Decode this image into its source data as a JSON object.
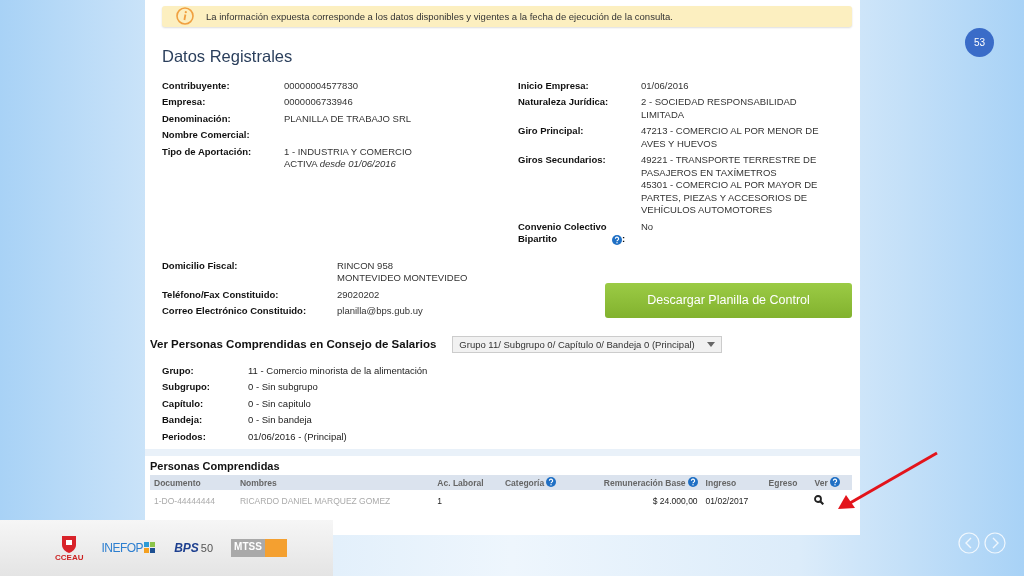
{
  "notice": {
    "text": "La información expuesta corresponde a los datos disponibles y vigentes a la fecha de ejecución de la consulta."
  },
  "title": "Datos Registrales",
  "fields_left": [
    {
      "label": "Contribuyente:",
      "values": [
        "00000004577830"
      ]
    },
    {
      "label": "Empresa:",
      "values": [
        "0000006733946"
      ]
    },
    {
      "label": "Denominación:",
      "values": [
        "PLANILLA DE TRABAJO SRL"
      ]
    },
    {
      "label": "Nombre Comercial:"
    },
    {
      "label": "Tipo de Aportación:",
      "values": [
        "1 - INDUSTRIA Y COMERCIO",
        "ACTIVA *desde 01/06/2016*"
      ]
    }
  ],
  "fields_right": [
    {
      "label": "Inicio Empresa:",
      "values": [
        "01/06/2016"
      ]
    },
    {
      "label": "Naturaleza Jurídica:",
      "values": [
        "2 - SOCIEDAD RESPONSABILIDAD LIMITADA"
      ]
    },
    {
      "label": "Giro Principal:",
      "values": [
        "47213 - COMERCIO AL POR MENOR DE AVES Y HUEVOS"
      ]
    },
    {
      "label": "Giros Secundarios:",
      "values": [
        "49221 - TRANSPORTE TERRESTRE DE PASAJEROS EN TAXÍMETROS",
        "45301 - COMERCIO AL POR MAYOR DE PARTES, PIEZAS Y ACCESORIOS DE VEHÍCULOS AUTOMOTORES"
      ]
    },
    {
      "label": "Convenio Colectivo Bipartito",
      "help": true,
      "suffix": ":",
      "values": [
        "No"
      ]
    }
  ],
  "contact": [
    {
      "label": "Domicilio Fiscal:",
      "values": [
        "RINCON 958",
        "MONTEVIDEO MONTEVIDEO"
      ]
    },
    {
      "label": "Teléfono/Fax Constituido:",
      "values": [
        "29020202"
      ]
    },
    {
      "label": "Correo Electrónico Constituido:",
      "values": [
        "planilla@bps.gub.uy"
      ]
    }
  ],
  "download_button": "Descargar Planilla de Control",
  "consejo": {
    "heading": "Ver Personas Comprendidas en Consejo de Salarios",
    "dropdown": "Grupo 11/ Subgrupo 0/ Capítulo 0/ Bandeja 0 (Principal)",
    "fields": [
      {
        "label": "Grupo:",
        "value": "11 - Comercio minorista de la alimentación"
      },
      {
        "label": "Subgrupo:",
        "value": "0 - Sin subgrupo"
      },
      {
        "label": "Capítulo:",
        "value": "0 - Sin capitulo"
      },
      {
        "label": "Bandeja:",
        "value": "0 - Sin bandeja"
      },
      {
        "label": "Periodos:",
        "value": "01/06/2016 - (Principal)"
      }
    ]
  },
  "personas": {
    "heading": "Personas Comprendidas",
    "columns": [
      {
        "label": "Documento",
        "help": false,
        "kind": "text"
      },
      {
        "label": "Nombres",
        "help": false,
        "kind": "text"
      },
      {
        "label": "Ac. Laboral",
        "help": false,
        "kind": "text"
      },
      {
        "label": "Categoría",
        "help": true,
        "kind": "text"
      },
      {
        "label": "Remuneración Base",
        "help": true,
        "kind": "amount"
      },
      {
        "label": "Ingreso",
        "help": false,
        "kind": "text"
      },
      {
        "label": "Egreso",
        "help": false,
        "kind": "text"
      },
      {
        "label": "Ver",
        "help": true,
        "kind": "action"
      }
    ],
    "rows": [
      {
        "cells": [
          {
            "text": "1-DO-44444444",
            "faded": true
          },
          {
            "text": "RICARDO DANIEL MARQUEZ GOMEZ",
            "faded": true
          },
          {
            "text": "1",
            "faded": false
          },
          {},
          {
            "text": "$ 24.000,00",
            "faded": false
          },
          {
            "text": "01/02/2017",
            "faded": false
          },
          {},
          {}
        ]
      }
    ]
  },
  "slide_number": "53",
  "logos": {
    "cceau": "CCEAU",
    "inefop": "INEFOP",
    "bps": "BPS",
    "bps_years": "50",
    "mtss": "MTSS"
  }
}
